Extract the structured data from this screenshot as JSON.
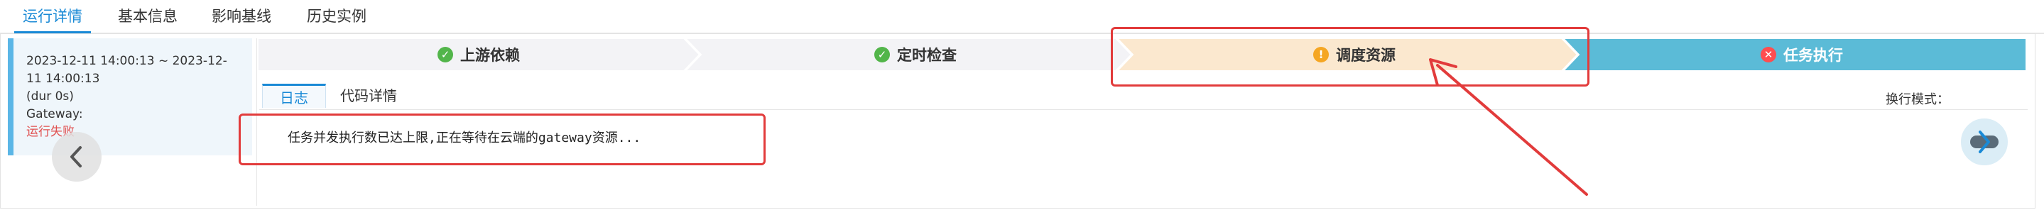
{
  "top_tabs": [
    {
      "label": "运行详情",
      "active": true
    },
    {
      "label": "基本信息",
      "active": false
    },
    {
      "label": "影响基线",
      "active": false
    },
    {
      "label": "历史实例",
      "active": false
    }
  ],
  "history": {
    "time_range": "2023-12-11 14:00:13 ~ 2023-12-",
    "time_range_cont": "11 14:00:13",
    "duration": "(dur 0s)",
    "gateway": "Gateway:",
    "status": "运行失败"
  },
  "steps": [
    {
      "label": "上游依赖",
      "state": "success",
      "icon": "check-icon"
    },
    {
      "label": "定时检查",
      "state": "success",
      "icon": "check-icon"
    },
    {
      "label": "调度资源",
      "state": "warning",
      "icon": "exclamation-icon"
    },
    {
      "label": "任务执行",
      "state": "error",
      "icon": "cross-icon"
    }
  ],
  "sub_tabs": [
    {
      "label": "日志",
      "active": true
    },
    {
      "label": "代码详情",
      "active": false
    }
  ],
  "mode_label": "换行模式：",
  "log": {
    "line1": "任务并发执行数已达上限,正在等待在云端的gateway资源..."
  },
  "colors": {
    "accent": "#1a8ad6",
    "step_done": "#f3f3f6",
    "step_warning": "#fbe8cf",
    "step_error": "#5bbbd7",
    "annotation": "#e23b3b",
    "failed_text": "#e05050"
  }
}
